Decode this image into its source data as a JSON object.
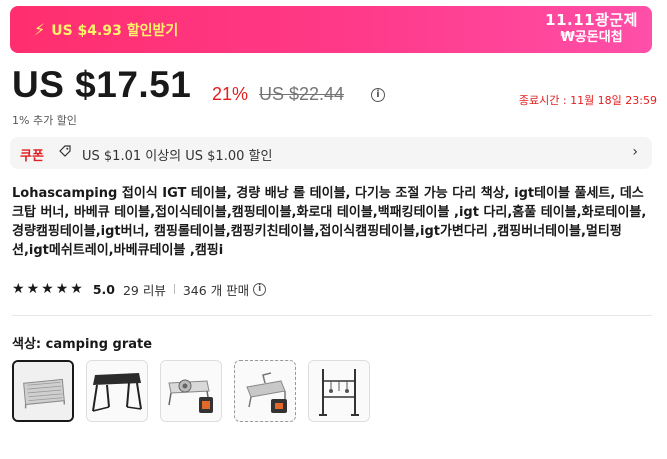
{
  "banner": {
    "coupon_text": "US $4.93 할인받기",
    "event_line1": "11.11광군제",
    "event_line2": "₩공돈대첩",
    "colors": {
      "bg_start": "#ff2e6e",
      "bg_end": "#ff4fa8",
      "coupon_text": "#fff36b"
    }
  },
  "price": {
    "current": "US $17.51",
    "discount": "21%",
    "original": "US $22.44",
    "end_time": "종료시간 :  11월 18일 23:59",
    "extra_discount": "1% 추가 할인"
  },
  "coupon": {
    "tag": "쿠폰",
    "text": "US $1.01 이상의 US $1.00 할인"
  },
  "product": {
    "title": "Lohascamping 접이식 IGT 테이블, 경량 배낭 롤 테이블, 다기능 조절 가능 다리 책상, igt테이블 풀세트, 데스크탑 버너, 바베큐 테이블,접이식테이블,캠핑테이블,화로대 테이블,백패킹테이블 ,igt 다리,홈풀 테이블,화로테이블,경량캠핑테이블,igt버너, 캠핑롤테이블,캠핑키친테이블,접이식캠핑테이블,igt가변다리 ,캠핑버너테이블,멀티펑션,igt메쉬트레이,바베큐테이블 ,캠핑i"
  },
  "rating": {
    "stars": 5,
    "score": "5.0",
    "reviews": "29 리뷰",
    "sold": "346 개 판매"
  },
  "variant": {
    "label": "색상",
    "selected": ": camping grate",
    "options": [
      "camping grate",
      "table",
      "burner set",
      "roll table",
      "hanging rack"
    ]
  }
}
